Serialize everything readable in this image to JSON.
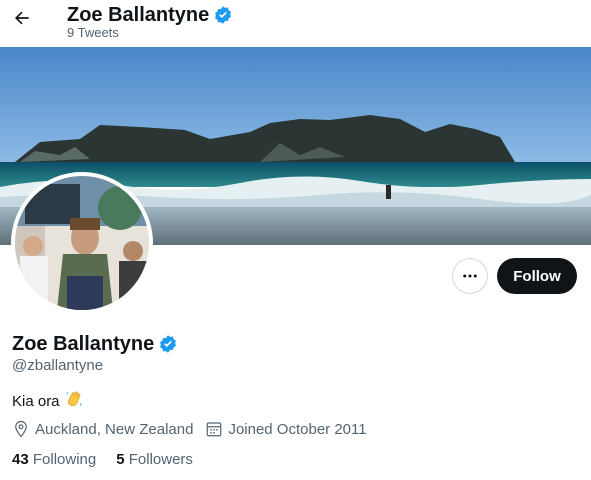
{
  "header": {
    "name": "Zoe Ballantyne",
    "tweet_count": "9 Tweets"
  },
  "profile": {
    "name": "Zoe Ballantyne",
    "handle": "@zballantyne",
    "bio": "Kia ora",
    "bio_emoji": "waving-hand-emoji",
    "location": "Auckland, New Zealand",
    "joined": "Joined October 2011",
    "following_count": "43",
    "following_label": "Following",
    "followers_count": "5",
    "followers_label": "Followers"
  },
  "actions": {
    "follow_label": "Follow",
    "more_icon": "more-icon"
  },
  "icons": {
    "back": "arrow-left-icon",
    "verified": "verified-badge-icon",
    "location": "location-pin-icon",
    "calendar": "calendar-icon"
  },
  "colors": {
    "accent": "#1d9bf0",
    "text": "#0f1419",
    "secondary": "#536471",
    "button_dark": "#0f1419"
  }
}
